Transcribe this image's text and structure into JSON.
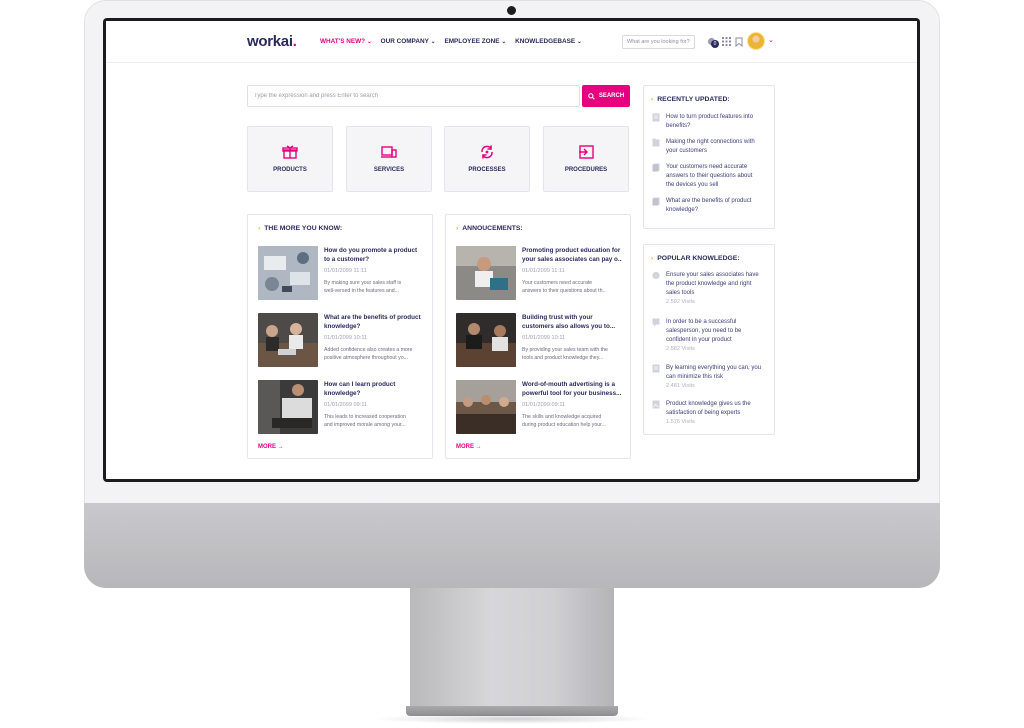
{
  "header": {
    "logo": "workai",
    "logo_dot": ".",
    "nav": [
      {
        "label": "WHAT'S NEW?",
        "active": true
      },
      {
        "label": "OUR COMPANY",
        "active": false
      },
      {
        "label": "EMPLOYEE ZONE",
        "active": false
      },
      {
        "label": "KNOWLEDGEBASE",
        "active": false
      }
    ],
    "search_placeholder": "What are you looking for?",
    "notifications_count": "0"
  },
  "kb_search": {
    "placeholder": "Type the expression and press Enter to search",
    "button_label": "SEARCH"
  },
  "categories": [
    "PRODUCTS",
    "SERVICES",
    "PROCESSES",
    "PROCEDURES"
  ],
  "more_you_know": {
    "title": "THE MORE YOU KNOW:",
    "articles": [
      {
        "title_1": "How do you promote a product",
        "title_2": "to a customer?",
        "date": "01/01/2099 11:11",
        "text_1": "By making sure your sales staff is",
        "text_2": "well-versed in the features and..."
      },
      {
        "title_1": "What are the benefits of product",
        "title_2": "knowledge?",
        "date": "01/01/2099 10:11",
        "text_1": "Added confidence also creates a more",
        "text_2": "positive atmosphere throughout yo..."
      },
      {
        "title_1": "How can I learn product",
        "title_2": "knowledge?",
        "date": "01/01/2099 09:11",
        "text_1": "This leads to increased cooperation",
        "text_2": "and improved morale among your..."
      }
    ],
    "more_label": "MORE →"
  },
  "announcements": {
    "title": "ANNOUCEMENTS:",
    "articles": [
      {
        "title_1": "Promoting product education for",
        "title_2": "your sales associates can pay o...",
        "date": "01/01/2099 11:11",
        "text_1": "Your customers need accurate",
        "text_2": "answers to their questions about th..."
      },
      {
        "title_1": "Building trust with your",
        "title_2": "customers also allows you to...",
        "date": "01/01/2099 10:11",
        "text_1": "By providing your sales team with the",
        "text_2": "tools and product knowledge they..."
      },
      {
        "title_1": "Word-of-mouth advertising is a",
        "title_2": "powerful tool for your business...",
        "date": "01/01/2099 09:11",
        "text_1": "The skills and knowledge acquired",
        "text_2": "during product education help your..."
      }
    ],
    "more_label": "MORE →"
  },
  "recently_updated": {
    "title": "RECENTLY UPDATED:",
    "items": [
      {
        "lines": [
          "How to turn product features into",
          "benefits?"
        ]
      },
      {
        "lines": [
          "Making the right connections with",
          "your customers"
        ]
      },
      {
        "lines": [
          "Your customers need accurate",
          "answers to their questions about",
          "the devices you sell"
        ]
      },
      {
        "lines": [
          "What are the benefits of product",
          "knowledge?"
        ]
      }
    ]
  },
  "popular_knowledge": {
    "title": "POPULAR KNOWLEDGE:",
    "items": [
      {
        "lines": [
          "Ensure your sales associates have",
          "the product knowledge and right",
          "sales tools"
        ],
        "visits": "2.592 Visits"
      },
      {
        "lines": [
          "In order to be a successful",
          "salesperson, you need to be",
          "confident in your product"
        ],
        "visits": "2.582 Visits"
      },
      {
        "lines": [
          "By learning everything you can, you",
          "can minimize this risk"
        ],
        "visits": "2.481 Visits"
      },
      {
        "lines": [
          "Product knowledge gives us the",
          "satisfaction of being experts"
        ],
        "visits": "1.576 Visits"
      }
    ]
  },
  "colors": {
    "accent": "#e6007e",
    "navy": "#2b2a5c",
    "arrow": "#f5a623"
  }
}
